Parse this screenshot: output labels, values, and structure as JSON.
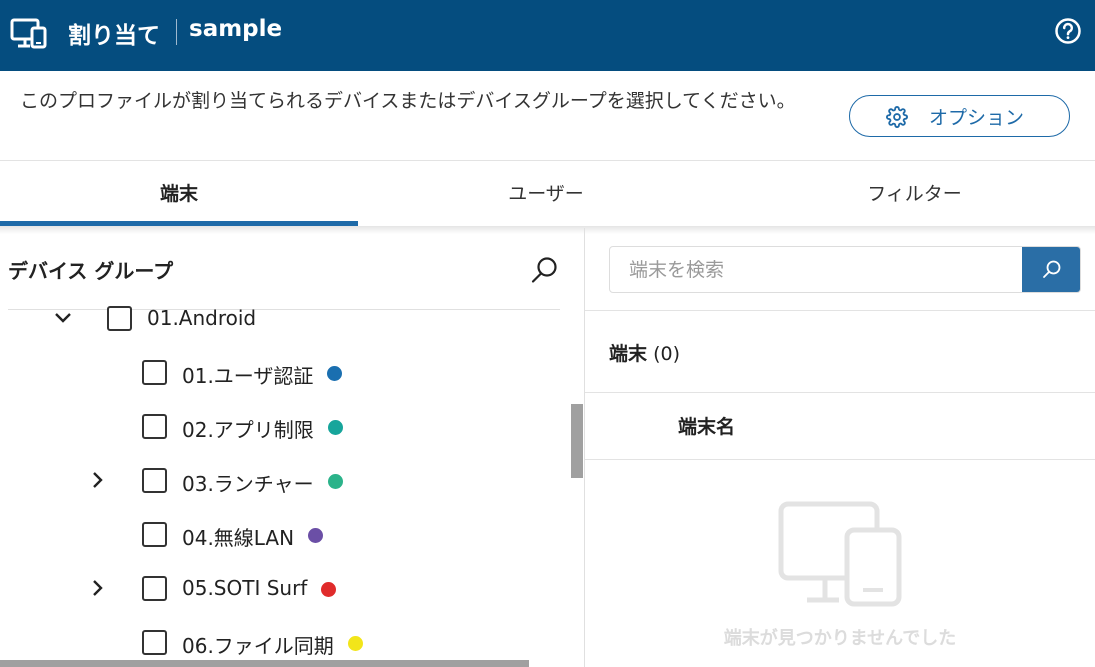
{
  "header": {
    "title": "割り当て",
    "name": "sample"
  },
  "description": "このプロファイルが割り当てられるデバイスまたはデバイスグループを選択してください。",
  "options_label": "オプション",
  "tabs": [
    {
      "label": "端末",
      "active": true
    },
    {
      "label": "ユーザー",
      "active": false
    },
    {
      "label": "フィルター",
      "active": false
    }
  ],
  "device_groups": {
    "title": "デバイス グループ",
    "root": {
      "label": "01.Android",
      "expanded": true
    },
    "items": [
      {
        "label": "01.ユーザ認証",
        "color": "#1a6fb0",
        "expandable": false
      },
      {
        "label": "02.アプリ制限",
        "color": "#17a59b",
        "expandable": false
      },
      {
        "label": "03.ランチャー",
        "color": "#2bb38a",
        "expandable": true
      },
      {
        "label": "04.無線LAN",
        "color": "#6b4fa6",
        "expandable": false
      },
      {
        "label": "05.SOTI Surf",
        "color": "#e02b2b",
        "expandable": true
      },
      {
        "label": "06.ファイル同期",
        "color": "#f2e51a",
        "expandable": false
      }
    ]
  },
  "devices": {
    "search_placeholder": "端末を検索",
    "count_label": "端末",
    "count_value": "(0)",
    "column_header": "端末名",
    "empty_text": "端末が見つかりませんでした"
  }
}
